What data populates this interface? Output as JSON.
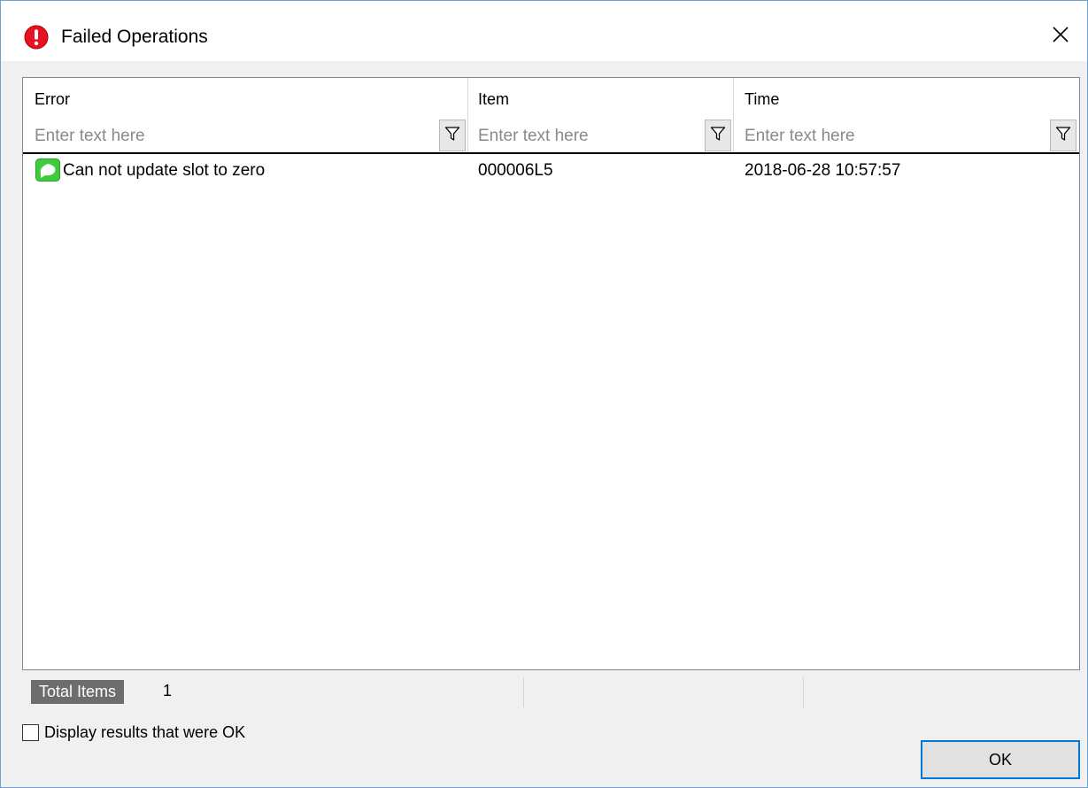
{
  "window": {
    "title": "Failed Operations",
    "title_icon": "error-icon",
    "close_icon": "close-icon"
  },
  "grid": {
    "columns": [
      {
        "title": "Error",
        "filter_placeholder": "Enter text here"
      },
      {
        "title": "Item",
        "filter_placeholder": "Enter text here"
      },
      {
        "title": "Time",
        "filter_placeholder": "Enter text here"
      }
    ],
    "filter_icon": "filter-icon",
    "rows": [
      {
        "icon": "message-bubble-icon",
        "error": "Can not update slot to zero",
        "item": "000006L5",
        "time": "2018-06-28 10:57:57"
      }
    ]
  },
  "status": {
    "total_label": "Total Items",
    "total_value": "1"
  },
  "options": {
    "display_ok_label": "Display results that were OK",
    "display_ok_checked": false
  },
  "buttons": {
    "ok_label": "OK"
  },
  "colors": {
    "accent": "#0078d7",
    "error_icon": "#e81123",
    "message_icon": "#3dcc3d"
  }
}
